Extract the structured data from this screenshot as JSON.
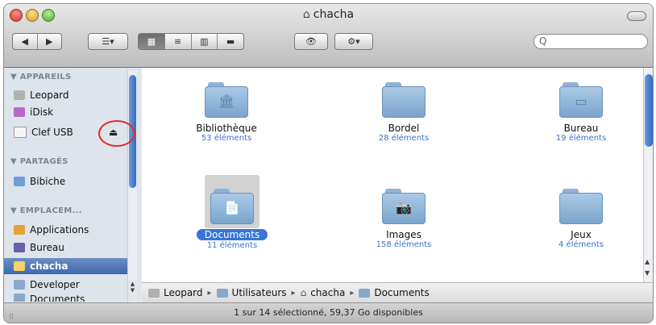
{
  "window": {
    "title": "chacha",
    "title_icon": "home-icon"
  },
  "toolbar": {
    "back_label": "◀",
    "forward_label": "▶",
    "arrange_label": "☰▾",
    "view_icon_label": "▦",
    "view_list_label": "≡",
    "view_columns_label": "▥",
    "view_coverflow_label": "▬",
    "quicklook_label": "👁",
    "action_label": "⚙▾",
    "search_placeholder": "Q"
  },
  "sidebar": {
    "sections": [
      {
        "header": "▼ APPAREILS",
        "items": [
          {
            "label": "Leopard",
            "icon": "hard-drive-icon",
            "color": "#b0b0b0"
          },
          {
            "label": "iDisk",
            "icon": "idisk-icon",
            "color": "#b868c8"
          },
          {
            "label": "Clef USB",
            "icon": "usb-drive-icon",
            "color": "#f2f2f2",
            "eject": "⏏"
          }
        ]
      },
      {
        "header": "▼ PARTAGÉS",
        "items": [
          {
            "label": "Bibiche",
            "icon": "computer-icon",
            "color": "#6f9fd6"
          }
        ]
      },
      {
        "header": "▼ EMPLACEM...",
        "items": [
          {
            "label": "Applications",
            "icon": "applications-icon",
            "color": "#e6a23a"
          },
          {
            "label": "Bureau",
            "icon": "desktop-icon",
            "color": "#6a5fa8"
          },
          {
            "label": "chacha",
            "icon": "home-icon",
            "color": "#f5d36a",
            "selected": true
          },
          {
            "label": "Developer",
            "icon": "folder-icon",
            "color": "#86a9cc"
          },
          {
            "label": "Documents",
            "icon": "folder-icon",
            "color": "#86a9cc"
          }
        ]
      }
    ]
  },
  "folders": [
    {
      "name": "Bibliothèque",
      "count": "53 éléments",
      "emblem": "🏛"
    },
    {
      "name": "Bordel",
      "count": "28 éléments",
      "emblem": ""
    },
    {
      "name": "Bureau",
      "count": "19 éléments",
      "emblem": "▭"
    },
    {
      "name": "Documents",
      "count": "11 éléments",
      "emblem": "📄",
      "selected": true
    },
    {
      "name": "Images",
      "count": "158 éléments",
      "emblem": "📷"
    },
    {
      "name": "Jeux",
      "count": "4 éléments",
      "emblem": ""
    }
  ],
  "pathbar": [
    "Leopard",
    "Utilisateurs",
    "chacha",
    "Documents"
  ],
  "status": "1 sur 14 sélectionné, 59,37 Go disponibles"
}
